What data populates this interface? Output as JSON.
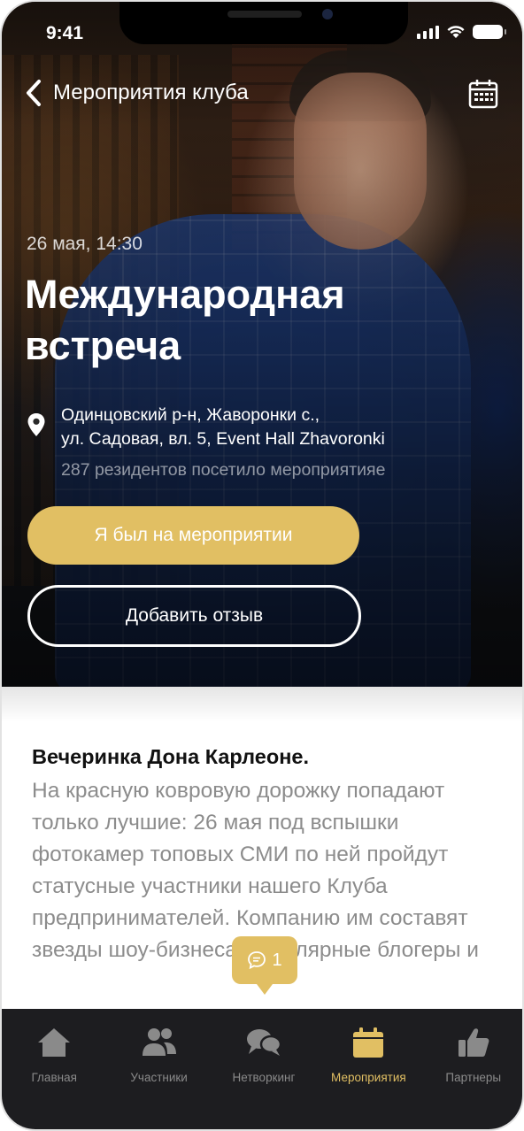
{
  "status_bar": {
    "time": "9:41"
  },
  "nav": {
    "back_label": "Мероприятия клуба"
  },
  "event": {
    "date": "26 мая, 14:30",
    "title": "Международная встреча",
    "location_line1": "Одинцовский р-н, Жаворонки с.,",
    "location_line2": "ул. Садовая, вл. 5, Event Hall Zhavoronki",
    "visitors_text": "287 резидентов посетило мероприятияе"
  },
  "actions": {
    "attended_label": "Я был на мероприятии",
    "review_label": "Добавить отзыв"
  },
  "description": {
    "title": "Вечеринка Дона Карлеоне.",
    "body": "На красную ковровую дорожку попадают только лучшие: 26 мая под вспышки фотокамер топовых СМИ по ней пройдут статусные участники нашего Клуба предпринимателей. Компанию им составят звезды шоу-бизнеса, популярные блогеры и"
  },
  "comments": {
    "count": "1"
  },
  "tabbar": {
    "items": [
      {
        "label": "Главная",
        "icon": "home-icon"
      },
      {
        "label": "Участники",
        "icon": "people-icon"
      },
      {
        "label": "Нетворкинг",
        "icon": "chat-bubbles-icon"
      },
      {
        "label": "Мероприятия",
        "icon": "calendar-icon"
      },
      {
        "label": "Партнеры",
        "icon": "thumbs-up-icon"
      }
    ],
    "active": "Мероприятия"
  },
  "colors": {
    "accent": "#e1bf63",
    "tabbar_bg": "#1d1d20",
    "inactive": "#8a8a8a"
  }
}
